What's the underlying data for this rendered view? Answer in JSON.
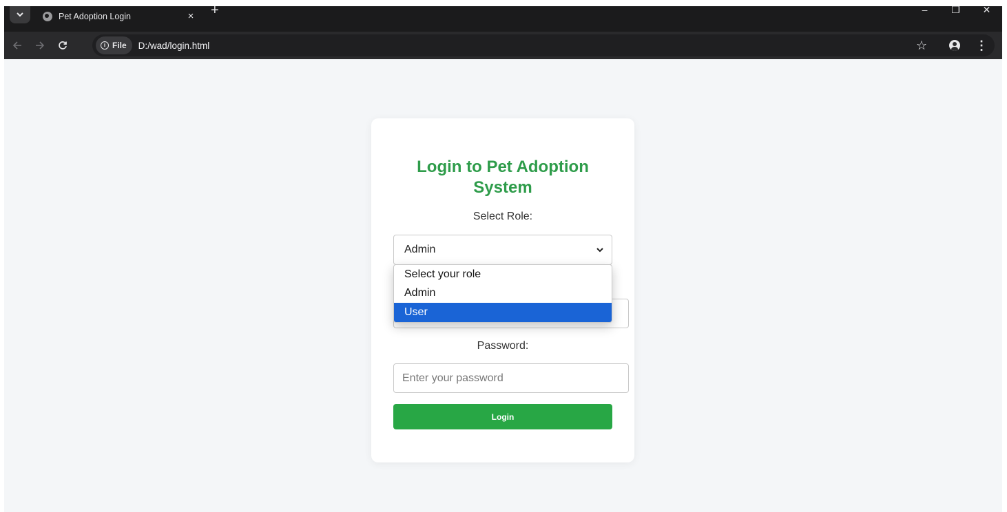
{
  "browser": {
    "tab_title": "Pet Adoption Login",
    "tab_close": "×",
    "new_tab": "+",
    "site_chip_label": "File",
    "url": "D:/wad/login.html",
    "window_controls": {
      "minimize": "–",
      "restore": "❐",
      "close": "✕"
    }
  },
  "page": {
    "title_line1": "Login to Pet Adoption",
    "title_line2": "System",
    "role_label": "Select Role:",
    "role_selected": "Admin",
    "role_options": [
      "Select your role",
      "Admin",
      "User"
    ],
    "highlighted_option": "User",
    "password_label": "Password:",
    "password_placeholder": "Enter your password",
    "login_label": "Login"
  },
  "colors": {
    "accent": "#2e9c4a",
    "button": "#28a745",
    "highlight": "#1a64d6"
  }
}
